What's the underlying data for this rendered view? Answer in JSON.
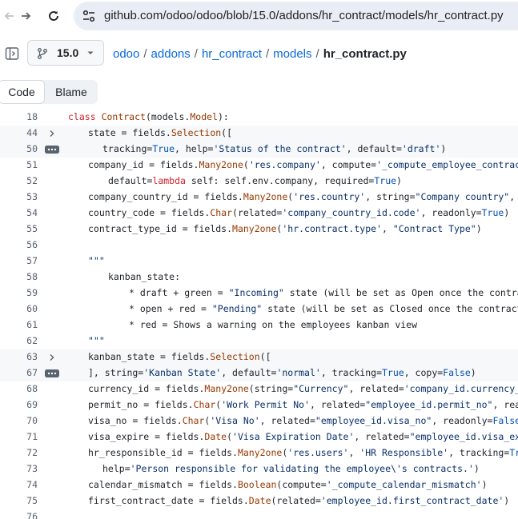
{
  "browser": {
    "url": "github.com/odoo/odoo/blob/15.0/addons/hr_contract/models/hr_contract.py"
  },
  "repo": {
    "branch": "15.0",
    "breadcrumb": [
      "odoo",
      "addons",
      "hr_contract",
      "models"
    ],
    "file": "hr_contract.py"
  },
  "tabs": {
    "code": "Code",
    "blame": "Blame"
  },
  "code_lines": [
    {
      "num": "18",
      "indent": 0,
      "marker": "",
      "text": "class Contract(models.Model):"
    },
    {
      "num": "44",
      "indent": 2,
      "marker": "chevron",
      "text": "state = fields.Selection(["
    },
    {
      "num": "50",
      "indent": 3,
      "marker": "dots",
      "text": "tracking=True, help='Status of the contract', default='draft')"
    },
    {
      "num": "51",
      "indent": 2,
      "marker": "",
      "text": "company_id = fields.Many2one('res.company', compute='_compute_employee_contract', store=True, readonly=False,"
    },
    {
      "num": "52",
      "indent": 4,
      "marker": "",
      "text": "default=lambda self: self.env.company, required=True)"
    },
    {
      "num": "53",
      "indent": 2,
      "marker": "",
      "text": "company_country_id = fields.Many2one('res.country', string=\"Company country\", related='company_id.country_id', readonly=True)"
    },
    {
      "num": "54",
      "indent": 2,
      "marker": "",
      "text": "country_code = fields.Char(related='company_country_id.code', readonly=True)"
    },
    {
      "num": "55",
      "indent": 2,
      "marker": "",
      "text": "contract_type_id = fields.Many2one('hr.contract.type', \"Contract Type\")"
    },
    {
      "num": "56",
      "indent": 0,
      "marker": "",
      "text": ""
    },
    {
      "num": "57",
      "indent": 2,
      "marker": "",
      "text": "\"\"\""
    },
    {
      "num": "58",
      "indent": 4,
      "marker": "",
      "text": "kanban_state:"
    },
    {
      "num": "59",
      "indent": 6,
      "marker": "",
      "text": "* draft + green = \"Incoming\" state (will be set as Open once the contract has started)"
    },
    {
      "num": "60",
      "indent": 6,
      "marker": "",
      "text": "* open + red = \"Pending\" state (will be set as Closed once the contract has ended)"
    },
    {
      "num": "61",
      "indent": 6,
      "marker": "",
      "text": "* red = Shows a warning on the employees kanban view"
    },
    {
      "num": "62",
      "indent": 2,
      "marker": "",
      "text": "\"\"\""
    },
    {
      "num": "63",
      "indent": 2,
      "marker": "chevron",
      "text": "kanban_state = fields.Selection(["
    },
    {
      "num": "67",
      "indent": 2,
      "marker": "dots",
      "text": "], string='Kanban State', default='normal', tracking=True, copy=False)"
    },
    {
      "num": "68",
      "indent": 2,
      "marker": "",
      "text": "currency_id = fields.Many2one(string=\"Currency\", related='company_id.currency_id', readonly=True)"
    },
    {
      "num": "69",
      "indent": 2,
      "marker": "",
      "text": "permit_no = fields.Char('Work Permit No', related=\"employee_id.permit_no\", readonly=False)"
    },
    {
      "num": "70",
      "indent": 2,
      "marker": "",
      "text": "visa_no = fields.Char('Visa No', related=\"employee_id.visa_no\", readonly=False)"
    },
    {
      "num": "71",
      "indent": 2,
      "marker": "",
      "text": "visa_expire = fields.Date('Visa Expiration Date', related=\"employee_id.visa_expire\", readonly=False)"
    },
    {
      "num": "72",
      "indent": 2,
      "marker": "",
      "text": "hr_responsible_id = fields.Many2one('res.users', 'HR Responsible', tracking=True,"
    },
    {
      "num": "73",
      "indent": 3,
      "marker": "",
      "text": "help='Person responsible for validating the employee\\'s contracts.')"
    },
    {
      "num": "74",
      "indent": 2,
      "marker": "",
      "text": "calendar_mismatch = fields.Boolean(compute='_compute_calendar_mismatch')"
    },
    {
      "num": "75",
      "indent": 2,
      "marker": "",
      "text": "first_contract_date = fields.Date(related='employee_id.first_contract_date')"
    },
    {
      "num": "76",
      "indent": 0,
      "marker": "",
      "text": ""
    }
  ]
}
